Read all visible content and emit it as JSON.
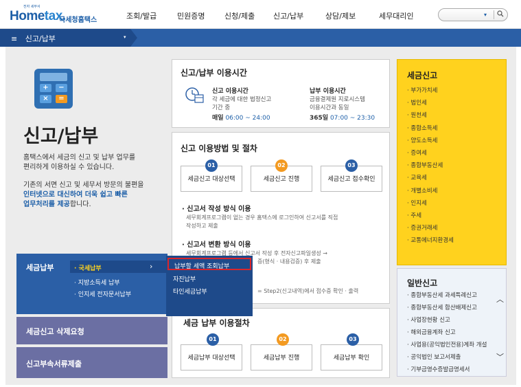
{
  "logo": {
    "tagline": "전자 세무서",
    "home": "Home",
    "tax": "tax.",
    "nts": "국세청홈택스"
  },
  "gnb": [
    "조회/발급",
    "민원증명",
    "신청/제출",
    "신고/납부",
    "상담/제보",
    "세무대리인"
  ],
  "search": {
    "dropdown": "▾",
    "icon": "search-icon"
  },
  "subbar": {
    "label": "신고/납부",
    "menu_icon": "≡",
    "dropdown_icon": "▾"
  },
  "hero": {
    "title": "신고/납부",
    "desc1": "홈택스에서 세금의 신고 및 납부 업무를",
    "desc2": "편리하게 이용하실 수 있습니다.",
    "desc3": "기존의 서면 신고 및 세무서 방문의 불편을",
    "desc4a": "인터넷으로 대신하여 더욱 쉽고 빠른",
    "desc5a": "업무처리를 제공",
    "desc5b": "합니다.",
    "calc_keys": [
      "+",
      "−",
      "×",
      "="
    ]
  },
  "left_menu": {
    "payment": {
      "title": "세금납부",
      "items": [
        "· 국세납부",
        "· 지방소득세 납부",
        "· 인지세 전자문서납부"
      ],
      "arrow": "›"
    },
    "delete_request": "세금신고 삭제요청",
    "attach_docs": "신고부속서류제출"
  },
  "popup": {
    "items": [
      "납부할 세액 조회납부",
      "자진납부",
      "타인세금납부"
    ]
  },
  "hours": {
    "title": "신고/납부 이용시간",
    "report": {
      "title": "신고 이용시간",
      "l1": "각 세금에 대한 법정신고",
      "l2": "기간 중",
      "time_label": "매일",
      "time": "06:00 ~ 24:00"
    },
    "payment": {
      "title": "납부 이용시간",
      "l1": "금융결제원 지로시스템",
      "l2": "이용시간과 동일",
      "time_label": "365일",
      "time": "07:00 ~ 23:30"
    }
  },
  "procedure": {
    "title": "신고 이용방법 및 절차",
    "steps": [
      {
        "num": "01",
        "label": "세금신고 대상선택"
      },
      {
        "num": "02",
        "label": "세금신고 진행"
      },
      {
        "num": "03",
        "label": "세금신고 접수확인"
      }
    ],
    "m1_title": "신고서 작성 방식 이용",
    "m1_l1": "세무회계프로그램이 없는 경우 홈택스에 로그인하여 신고서를 직접",
    "m1_l2": "작성하고 제출",
    "m2_title": "신고서 변환 방식 이용",
    "m2_l1": "세무회계프로그램 등에서 신고서 작성 후 전자신고파일생성 →",
    "m2_l2": "증(형식 · 내용검증) 후 제출",
    "m3_l1": "Step2(신고내역)에서 접수증 확인 · 출력",
    "m3_prefix": "="
  },
  "pay_procedure": {
    "title": "세금 납부 이용절차",
    "steps": [
      {
        "num": "01",
        "label": "세금납부 대상선택"
      },
      {
        "num": "02",
        "label": "세금납부 진행"
      },
      {
        "num": "03",
        "label": "세금납부 확인"
      }
    ]
  },
  "tax_report": {
    "title": "세금신고",
    "items": [
      "· 부가가치세",
      "· 법인세",
      "· 원천세",
      "· 종합소득세",
      "· 양도소득세",
      "· 증여세",
      "· 종합부동산세",
      "· 교육세",
      "· 개별소비세",
      "· 인지세",
      "· 주세",
      "· 증권거래세",
      "· 교통에너지환경세"
    ]
  },
  "general_report": {
    "title": "일반신고",
    "items": [
      "· 종합부동산세 과세특례신고",
      "· 종합부동산세 합산배제신고",
      "· 사업장현황 신고",
      "· 해외금융계좌 신고",
      "· 사업용(공익법인전용)계좌 개설",
      "· 공익법인 보고서제출",
      "· 기부금영수증발급명세서"
    ],
    "scroll_up": "︿",
    "scroll_down": "﹀"
  },
  "colors": {
    "brand": "#1d5fa8",
    "nav": "#2b5fa6",
    "accent_orange": "#f39a21",
    "yellow": "#ffd21e",
    "highlight": "#d9262c"
  }
}
